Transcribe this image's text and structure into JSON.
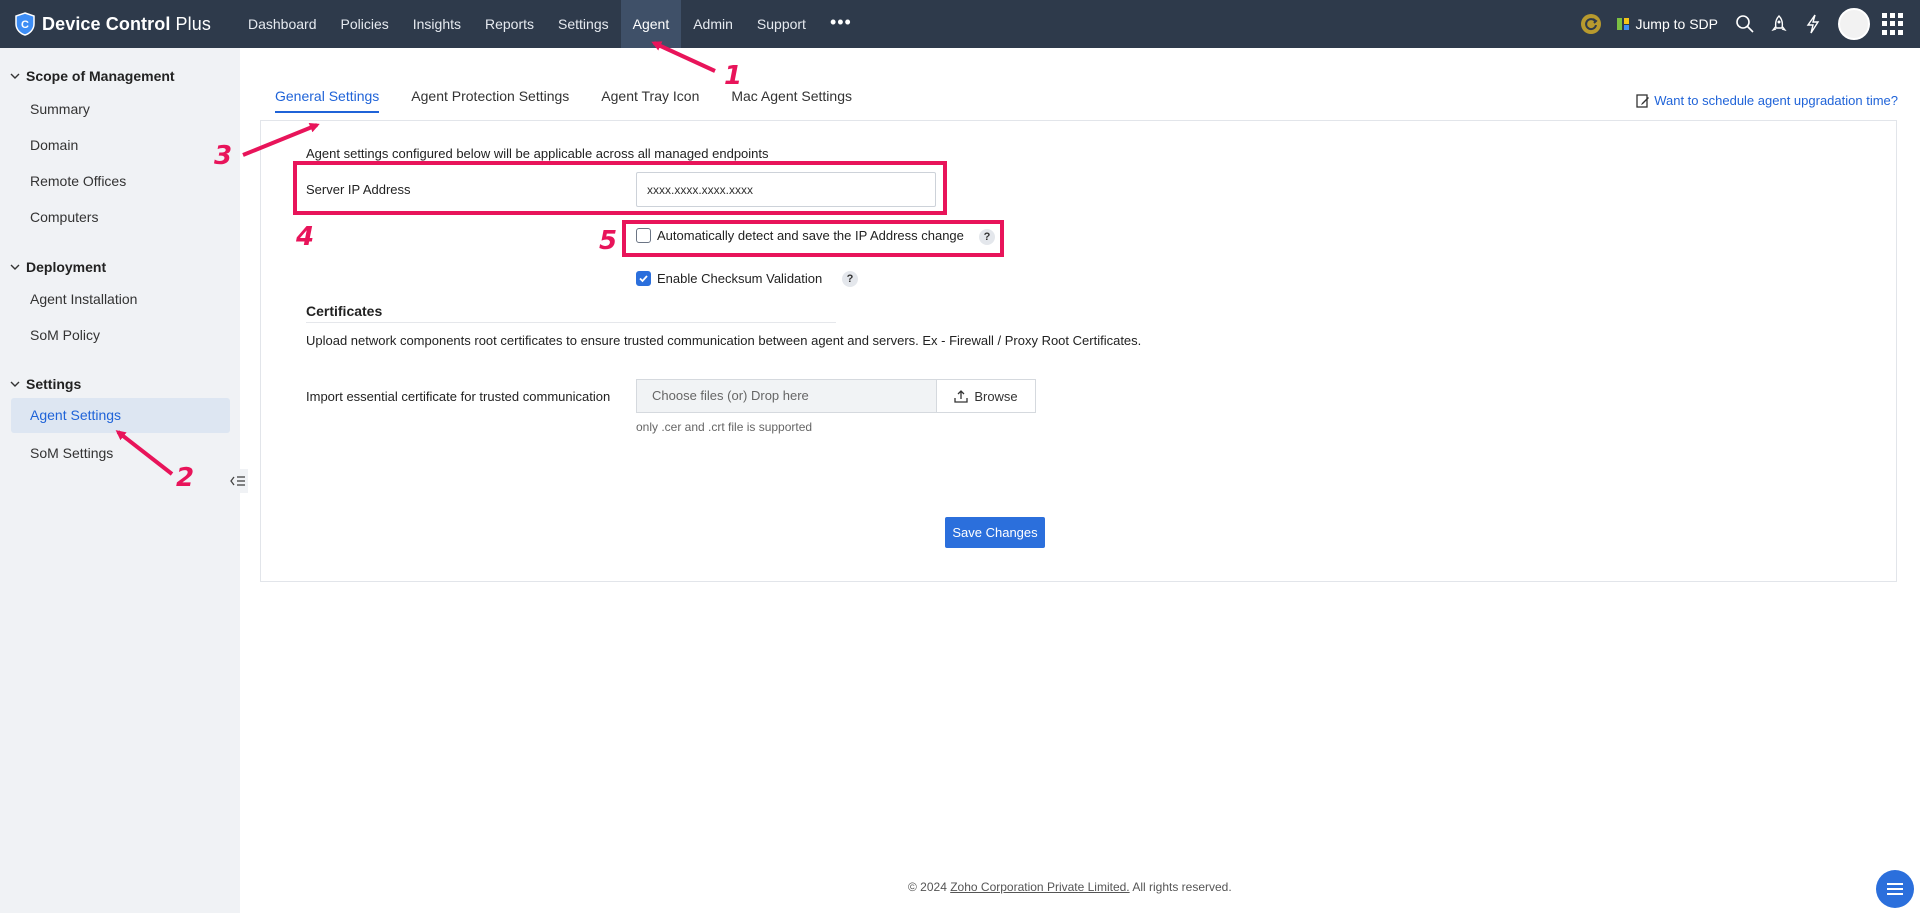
{
  "app": {
    "name_bold": "Device Control",
    "name_light": " Plus"
  },
  "nav": {
    "items": [
      "Dashboard",
      "Policies",
      "Insights",
      "Reports",
      "Settings",
      "Agent",
      "Admin",
      "Support"
    ],
    "active": "Agent",
    "more": "•••",
    "jump_label": "Jump to SDP"
  },
  "sidebar": {
    "sections": [
      {
        "title": "Scope of Management",
        "items": [
          "Summary",
          "Domain",
          "Remote Offices",
          "Computers"
        ]
      },
      {
        "title": "Deployment",
        "items": [
          "Agent Installation",
          "SoM Policy"
        ]
      },
      {
        "title": "Settings",
        "items": [
          "Agent Settings",
          "SoM Settings"
        ]
      }
    ],
    "active_item": "Agent Settings"
  },
  "tabs": [
    "General Settings",
    "Agent Protection Settings",
    "Agent Tray Icon",
    "Mac Agent Settings"
  ],
  "active_tab": "General Settings",
  "schedule_link": "Want to schedule agent upgradation time?",
  "form": {
    "info": "Agent settings configured below will be applicable across all managed endpoints",
    "server_ip_label": "Server IP Address",
    "server_ip_value": "xxxx.xxxx.xxxx.xxxx",
    "auto_detect_label": "Automatically detect and save the IP Address change",
    "auto_detect_checked": false,
    "checksum_label": "Enable Checksum Validation",
    "checksum_checked": true,
    "help": "?"
  },
  "certificates": {
    "title": "Certificates",
    "description": "Upload network components root certificates to ensure trusted communication between agent and servers. Ex - Firewall / Proxy Root Certificates.",
    "import_label": "Import essential certificate for trusted communication",
    "drop_placeholder": "Choose files (or) Drop here",
    "browse_label": "Browse",
    "hint": "only .cer and .crt file is supported"
  },
  "save_label": "Save Changes",
  "footer": {
    "prefix": "© 2024 ",
    "company": "Zoho Corporation Private Limited.",
    "suffix": " All rights reserved."
  },
  "annotations": [
    "1",
    "2",
    "3",
    "4",
    "5"
  ],
  "colors": {
    "topbar": "#2e3a4b",
    "accent": "#1f63d8",
    "button": "#2b6fdc",
    "annotation": "#e8145a",
    "sidebar": "#f0f2f5"
  }
}
